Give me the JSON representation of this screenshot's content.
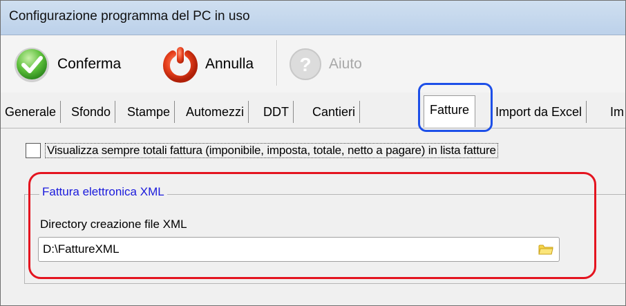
{
  "window": {
    "title": "Configurazione programma del PC in uso"
  },
  "toolbar": {
    "confirm_label": "Conferma",
    "cancel_label": "Annulla",
    "help_label": "Aiuto"
  },
  "tabs": [
    {
      "label": "Generale"
    },
    {
      "label": "Sfondo"
    },
    {
      "label": "Stampe"
    },
    {
      "label": "Automezzi"
    },
    {
      "label": "DDT"
    },
    {
      "label": "Cantieri"
    },
    {
      "label": "Fatture",
      "active": true
    },
    {
      "label": "Import da Excel"
    },
    {
      "label": "Im"
    }
  ],
  "invoices": {
    "show_totals_label": "Visualizza sempre totali fattura (imponibile, imposta, totale, netto a pagare) in lista fatture",
    "show_totals_checked": false,
    "xml_group_title": "Fattura elettronica XML",
    "xml_dir_label": "Directory creazione file XML",
    "xml_dir_value": "D:\\FattureXML"
  },
  "icons": {
    "confirm": "check-circle-icon",
    "cancel": "power-icon",
    "help": "question-circle-icon",
    "browse": "folder-icon"
  },
  "colors": {
    "tab_highlight": "#1d4fe8",
    "group_highlight": "#e4141f",
    "group_title": "#1a1adc"
  }
}
